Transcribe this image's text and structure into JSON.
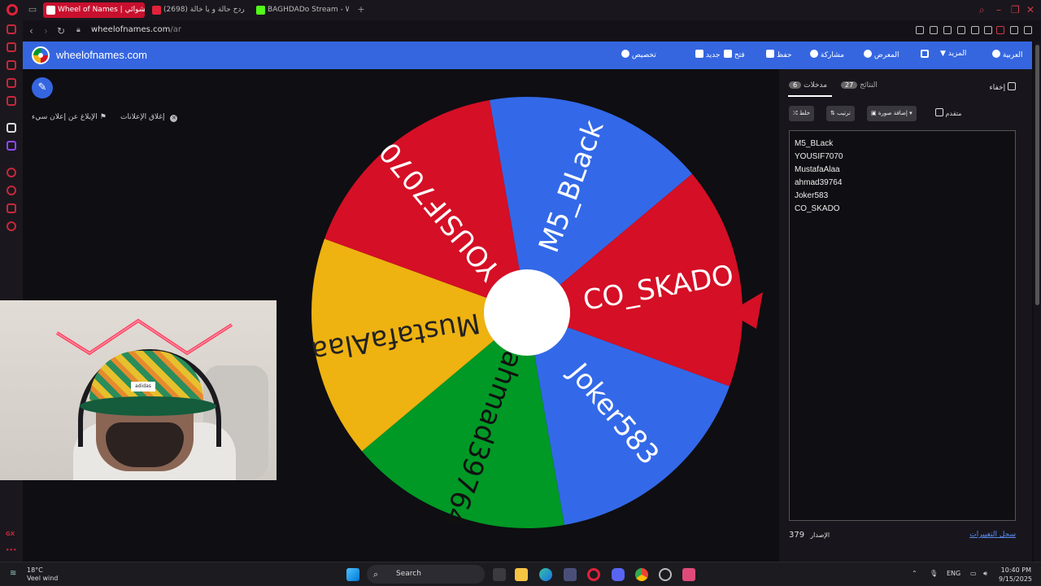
{
  "browser": {
    "tabs": [
      {
        "label": "Wheel of Names | عشوائي",
        "color": "#c8102e"
      },
      {
        "label": "(2698) ردح حالة و يا خالة -",
        "color": "#e0223a"
      },
      {
        "label": "BAGHDADo Stream - Watch",
        "color": "#53fc18"
      }
    ],
    "new_tab": "+",
    "url_host": "wheelofnames.com",
    "url_path": "/ar"
  },
  "site": {
    "name": "wheelofnames.com",
    "menu": {
      "customize": "تخصيص",
      "new": "جديد",
      "open": "فتح",
      "save": "حفظ",
      "share": "مشاركة",
      "gallery": "المعرض",
      "more": "المزيد",
      "language": "العربية"
    }
  },
  "ads": {
    "report_ad": "الإبلاغ عن إعلان سيء",
    "close_ads": "إغلاق الإعلانات"
  },
  "wheel": {
    "colors": {
      "blue": "#3369e8",
      "red": "#d50f25",
      "yellow": "#eeb211",
      "green": "#009925"
    },
    "segments": [
      {
        "label": "M5_BLack",
        "color": "#3369e8"
      },
      {
        "label": "CO_SKADO",
        "color": "#d50f25"
      },
      {
        "label": "Joker583",
        "color": "#3369e8"
      },
      {
        "label": "ahmad39764",
        "color": "#009925"
      },
      {
        "label": "MustafaAlaa",
        "color": "#eeb211"
      },
      {
        "label": "YOUSIF7070",
        "color": "#d50f25"
      }
    ]
  },
  "panel": {
    "entries_tab": "مدخلات",
    "entries_count": "6",
    "results_tab": "النتائج",
    "results_count": "27",
    "hide_label": "إخفاء",
    "shuffle": "خلط",
    "sort": "ترتيب",
    "add_image": "إضافة صورة",
    "advanced": "متقدم",
    "entries": [
      "M5_BLack",
      "YOUSIF7070",
      "MustafaAlaa",
      "ahmad39764",
      "Joker583",
      "CO_SKADO"
    ],
    "version_label": "الإصدار",
    "version_number": "379",
    "changelog": "سجل التغييرات"
  },
  "taskbar": {
    "temp": "18°C",
    "weather": "Veel wind",
    "search_placeholder": "Search",
    "lang": "ENG",
    "time": "10:40 PM",
    "date": "9/15/2025"
  }
}
